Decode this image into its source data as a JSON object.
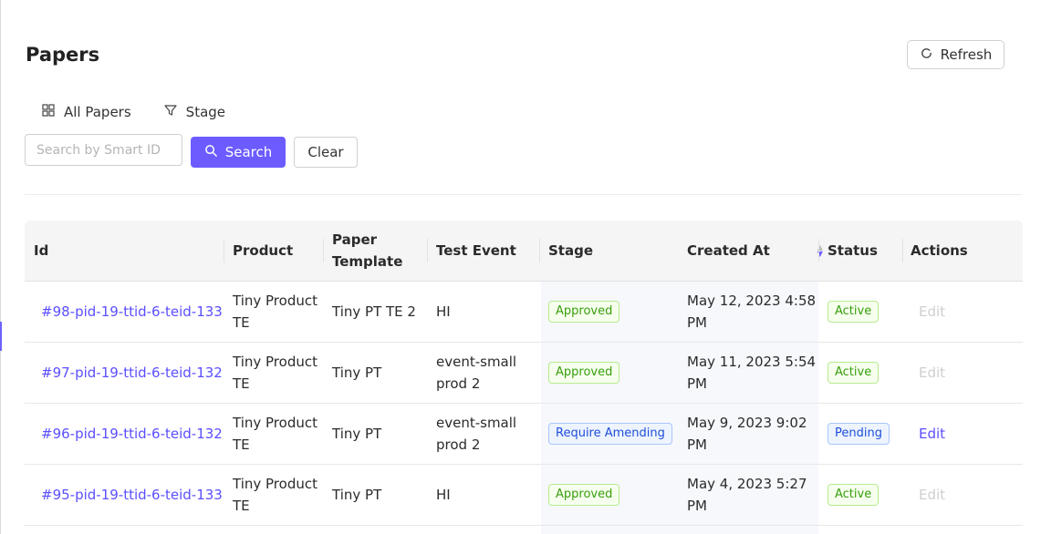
{
  "header": {
    "title": "Papers",
    "refresh_label": "Refresh"
  },
  "tabs": [
    {
      "label": "All Papers",
      "icon": "grid-icon"
    },
    {
      "label": "Stage",
      "icon": "filter-icon"
    }
  ],
  "search": {
    "placeholder": "Search by Smart ID",
    "value": "",
    "search_label": "Search",
    "clear_label": "Clear"
  },
  "table": {
    "columns": {
      "id": "Id",
      "product": "Product",
      "paper_template_1": "Paper",
      "paper_template_2": "Template",
      "test_event": "Test Event",
      "stage": "Stage",
      "created_at": "Created At",
      "status": "Status",
      "actions": "Actions"
    },
    "rows": [
      {
        "id": "#98-pid-19-ttid-6-teid-133",
        "product_1": "Tiny Product",
        "product_2": "TE",
        "paper_template": "Tiny PT TE 2",
        "test_event_1": "HI",
        "test_event_2": "",
        "stage": "Approved",
        "created_1": "May 12, 2023 4:58",
        "created_2": "PM",
        "status": "Active",
        "action": "Edit"
      },
      {
        "id": "#97-pid-19-ttid-6-teid-132",
        "product_1": "Tiny Product",
        "product_2": "TE",
        "paper_template": "Tiny PT",
        "test_event_1": "event-small",
        "test_event_2": "prod 2",
        "stage": "Approved",
        "created_1": "May 11, 2023 5:54",
        "created_2": "PM",
        "status": "Active",
        "action": "Edit"
      },
      {
        "id": "#96-pid-19-ttid-6-teid-132",
        "product_1": "Tiny Product",
        "product_2": "TE",
        "paper_template": "Tiny PT",
        "test_event_1": "event-small",
        "test_event_2": "prod 2",
        "stage": "Require Amending",
        "created_1": "May 9, 2023 9:02",
        "created_2": "PM",
        "status": "Pending",
        "action": "Edit"
      },
      {
        "id": "#95-pid-19-ttid-6-teid-133",
        "product_1": "Tiny Product",
        "product_2": "TE",
        "paper_template": "Tiny PT",
        "test_event_1": "HI",
        "test_event_2": "",
        "stage": "Approved",
        "created_1": "May 4, 2023 5:27",
        "created_2": "PM",
        "status": "Active",
        "action": "Edit"
      }
    ]
  },
  "colors": {
    "accent": "#6c5cff",
    "link": "#5b4fff",
    "tag_green": "#389e0d",
    "tag_blue": "#1d4ed8"
  }
}
